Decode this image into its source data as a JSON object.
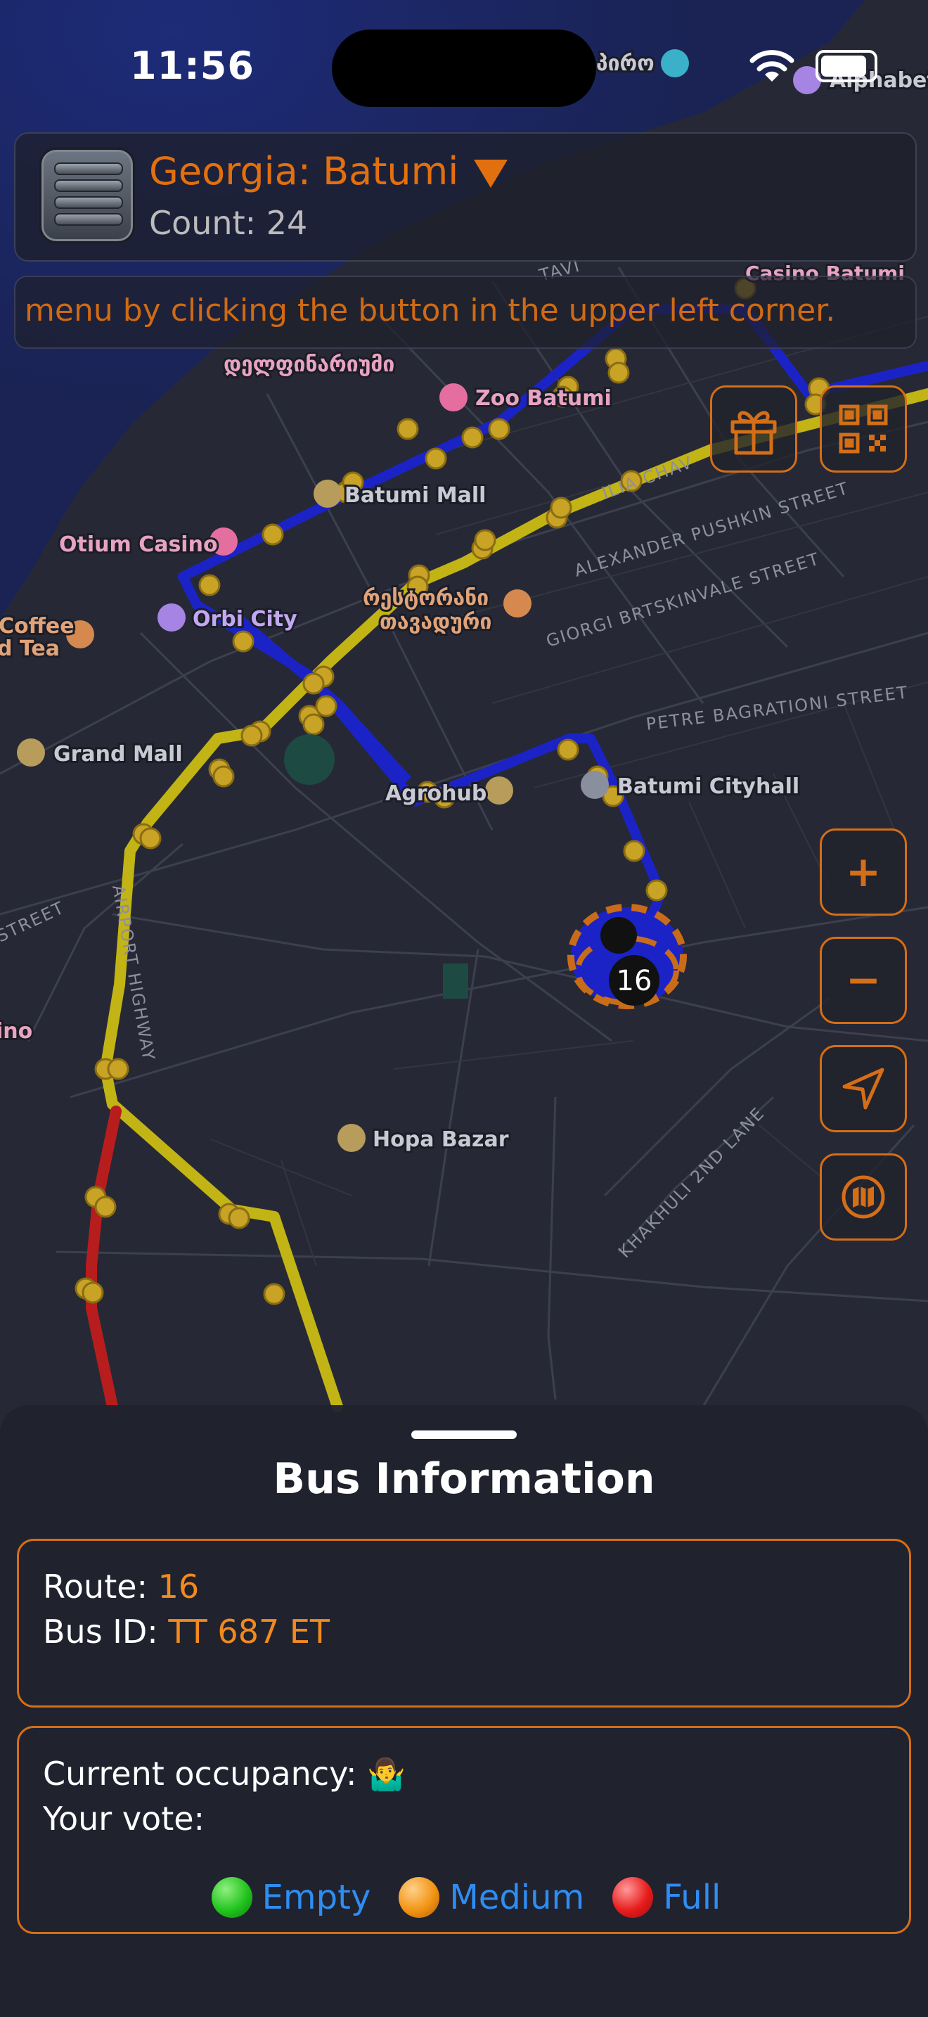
{
  "status_bar": {
    "time": "11:56"
  },
  "header": {
    "title": "Georgia: Batumi",
    "count_label": "Count: 24"
  },
  "ticker": {
    "text": "e menu by clicking the button in the upper left corner."
  },
  "map": {
    "route_marker_label": "16",
    "places": [
      "Alphabet",
      "Zoo Batumi",
      "Batumi Mall",
      "Otium Casino",
      "Orbi City",
      "Coffee",
      "d Tea",
      "Grand Mall",
      "Agrohub",
      "Batumi Cityhall",
      "Hopa Bazar",
      "რესტორანი",
      "თავადური",
      "დელფინარიუმი",
      "ino",
      "Casino Batumi",
      "პირო"
    ],
    "streets": [
      "ALEXANDER PUSHKIN STREET",
      "GIORGI BRTSKINVALE STREET",
      "PETRE BAGRATIONI STREET",
      "AIRPORT HIGHWAY",
      "KHAKHULI 2ND LANE",
      "STREET",
      "ILIA CHAV",
      "TAVI"
    ],
    "colors": {
      "route_blue": "#1b23c7",
      "route_yellow": "#c2b415",
      "route_red": "#b71d1d",
      "stop_dot": "#c9a326"
    }
  },
  "controls": {
    "gift_icon": "gift-icon",
    "qr_icon": "qr-code-icon",
    "zoom_in": "+",
    "zoom_out": "−",
    "locate_icon": "navigation-arrow-icon",
    "map_icon": "map-icon"
  },
  "sheet": {
    "title": "Bus Information",
    "route_label": "Route:",
    "route_value": "16",
    "bus_id_label": "Bus ID:",
    "bus_id_value": "TT 687 ET",
    "occupancy_label": "Current occupancy:",
    "occupancy_emoji": "🤷‍♂️",
    "your_vote_label": "Your vote:",
    "votes": [
      {
        "label": "Empty",
        "color": "#22c41e"
      },
      {
        "label": "Medium",
        "color": "#f29414"
      },
      {
        "label": "Full",
        "color": "#e81c1c"
      }
    ]
  },
  "theme": {
    "accent": "#d46e17",
    "link_blue": "#2f8df2"
  }
}
